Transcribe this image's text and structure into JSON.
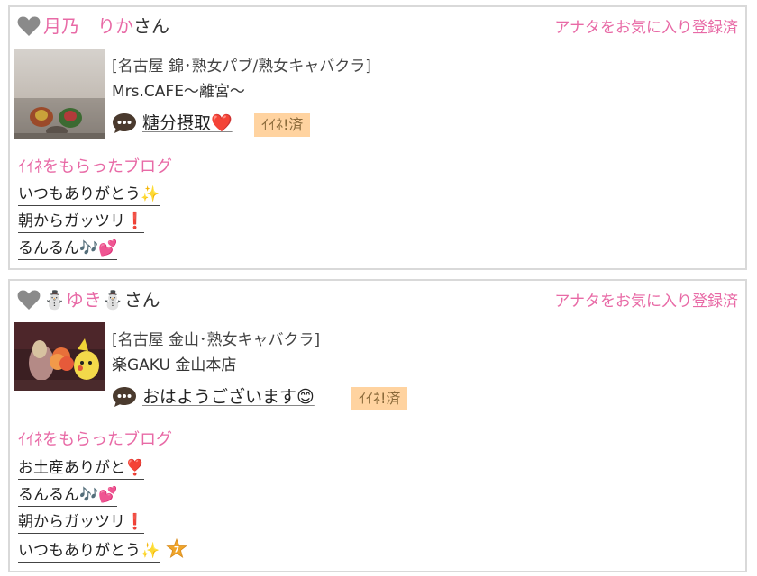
{
  "cards": [
    {
      "name": "月乃　りか",
      "honorific": "さん",
      "favorite_status": "アナタをお気に入り登録済",
      "shop_category": "[名古屋 錦･熟女パブ/熟女キャバクラ]",
      "shop_name": "Mrs.CAFE～離宮～",
      "blog_title": "糖分摂取❤️",
      "iine_badge": "ｲｲﾈ!済",
      "section_label": "ｲｲﾈをもらったブログ",
      "liked_blogs": [
        "いつもありがとう✨",
        "朝からガッツリ❗️",
        "るんるん🎶💕"
      ]
    },
    {
      "name": "ゆき",
      "honorific": "さん",
      "favorite_status": "アナタをお気に入り登録済",
      "shop_category": "[名古屋 金山･熟女キャバクラ]",
      "shop_name": "楽GAKU 金山本店",
      "blog_title": "おはようございます😊",
      "iine_badge": "ｲｲﾈ!済",
      "section_label": "ｲｲﾈをもらったブログ",
      "liked_blogs": [
        "お土産ありがと❣️",
        "るんるん🎶💕",
        "朝からガッツリ❗️",
        "いつもありがとう✨"
      ]
    }
  ],
  "colors": {
    "accent_pink": "#e86aa6",
    "badge_bg": "#ffd3a0",
    "heart_gray": "#8a8a8a",
    "border": "#d9d9d9"
  },
  "icons": {
    "favorite": "heart-icon",
    "comment": "speech-bubble-icon",
    "name_decoration": "snowman-icon",
    "rank_badge": "star-badge-icon"
  }
}
